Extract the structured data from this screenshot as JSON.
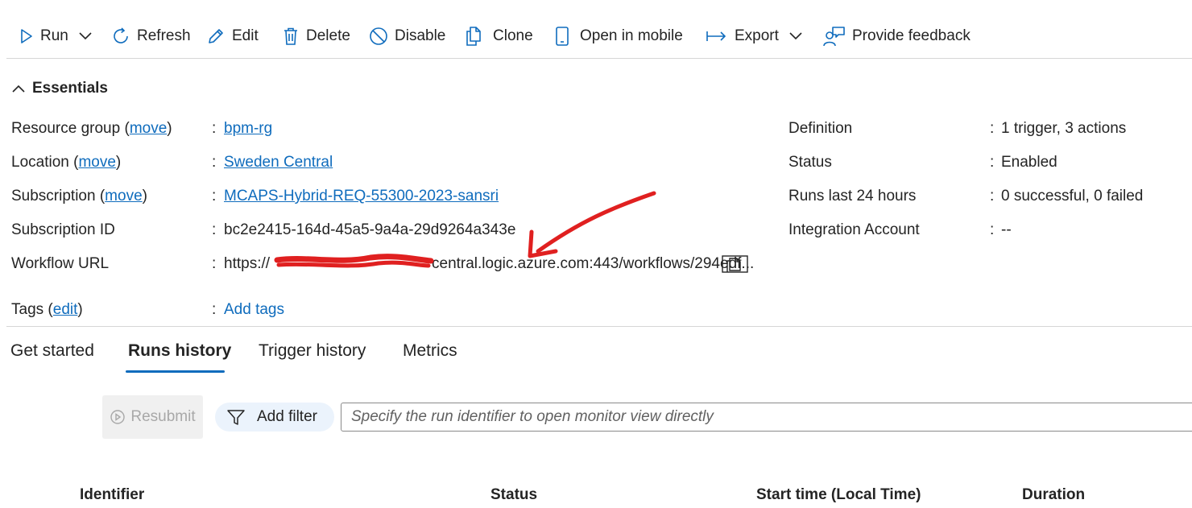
{
  "toolbar": {
    "run": "Run",
    "refresh": "Refresh",
    "edit": "Edit",
    "delete": "Delete",
    "disable": "Disable",
    "clone": "Clone",
    "open_mobile": "Open in mobile",
    "export": "Export",
    "feedback": "Provide feedback"
  },
  "essentials": {
    "title": "Essentials",
    "move": "move",
    "edit": "edit",
    "resource_group": {
      "label": "Resource group",
      "value": "bpm-rg"
    },
    "location": {
      "label": "Location",
      "value": "Sweden Central"
    },
    "subscription": {
      "label": "Subscription",
      "value": "MCAPS-Hybrid-REQ-55300-2023-sansri"
    },
    "subscription_id": {
      "label": "Subscription ID",
      "value": "bc2e2415-164d-45a5-9a4a-29d9264a343e"
    },
    "workflow_url": {
      "label": "Workflow URL",
      "value_prefix": "https://",
      "value_suffix": "central.logic.azure.com:443/workflows/294edf..."
    },
    "tags": {
      "label": "Tags",
      "value": "Add tags"
    },
    "definition": {
      "label": "Definition",
      "value": "1 trigger, 3 actions"
    },
    "status": {
      "label": "Status",
      "value": "Enabled"
    },
    "runs_last_24": {
      "label": "Runs last 24 hours",
      "value": "0 successful, 0 failed"
    },
    "integration_account": {
      "label": "Integration Account",
      "value": "--"
    }
  },
  "tabs": [
    "Get started",
    "Runs history",
    "Trigger history",
    "Metrics"
  ],
  "active_tab": "Runs history",
  "filters": {
    "resubmit": "Resubmit",
    "add_filter": "Add filter",
    "search_placeholder": "Specify the run identifier to open monitor view directly"
  },
  "table": {
    "columns": [
      "Identifier",
      "Status",
      "Start time (Local Time)",
      "Duration"
    ]
  },
  "colors": {
    "accent": "#0f6cbd",
    "annotation": "#e02020"
  }
}
